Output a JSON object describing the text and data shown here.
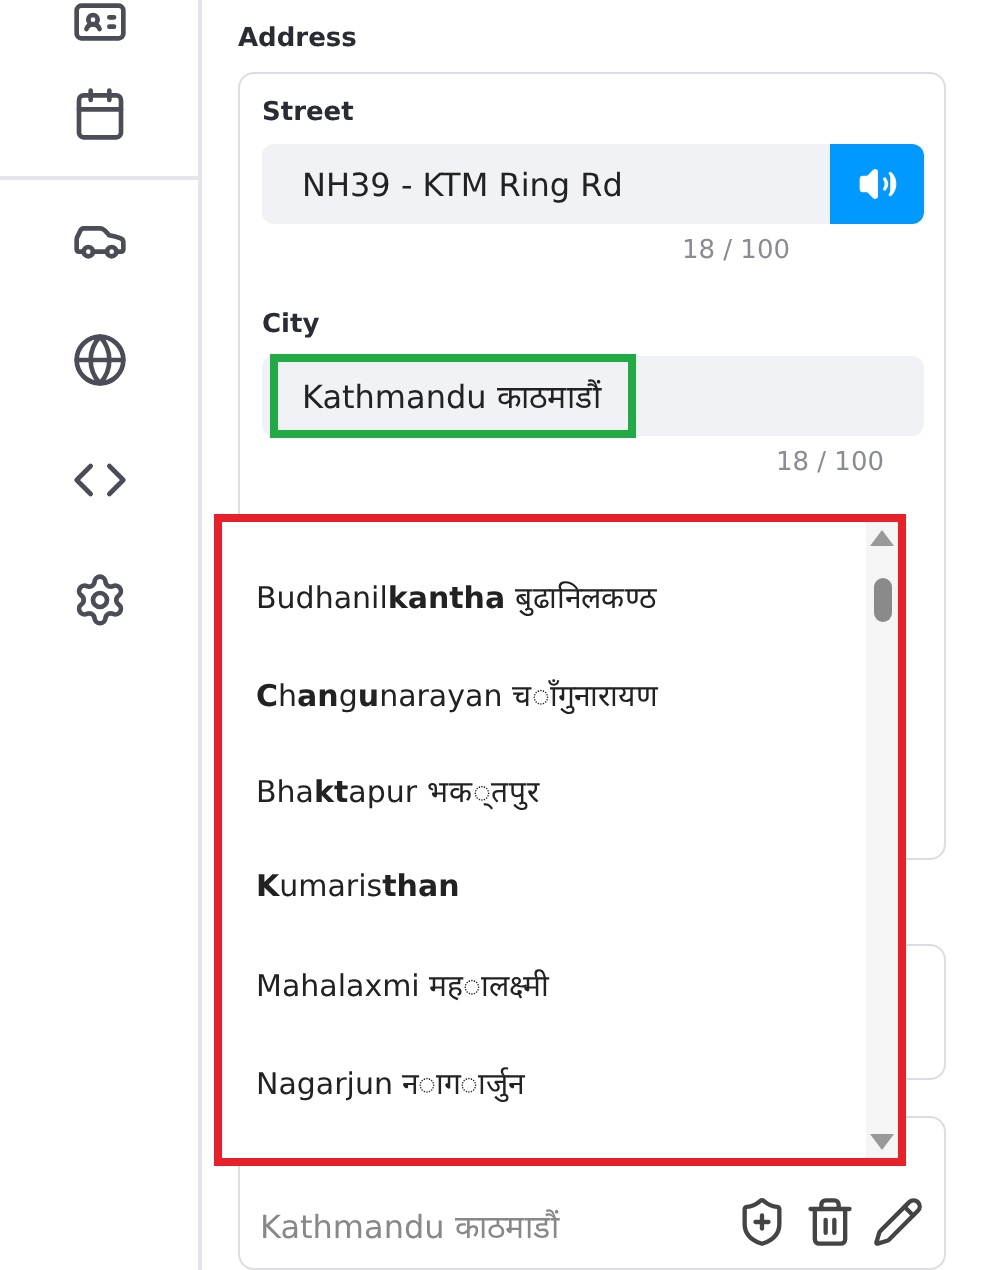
{
  "address": {
    "label": "Address",
    "street": {
      "label": "Street",
      "value": "NH39 - KTM Ring Rd",
      "counter": "18 / 100"
    },
    "city": {
      "label": "City",
      "value": "Kathmandu काठमाडौं",
      "counter": "18 / 100",
      "highlighted": true
    },
    "suggestions": {
      "highlighted": true,
      "items": [
        {
          "label": "Budhanil**kantha** बुढानिलकण्ठ"
        },
        {
          "label": "**C**h**an**g**u**narayan च◌ाँगुनारायण"
        },
        {
          "label": "Bha**kt**apur भक◌्तपुर"
        },
        {
          "label": "**K**umaris**than**"
        },
        {
          "label": "Mahalaxmi मह◌ालक्ष्मी"
        },
        {
          "label": "Nagarjun न◌ाग◌ार्जुन"
        }
      ]
    }
  },
  "saved_address": {
    "line": "Kathmandu काठमाडौं"
  }
}
